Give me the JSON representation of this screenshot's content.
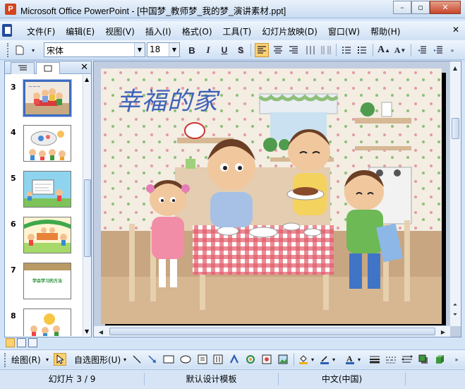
{
  "window": {
    "title": "Microsoft Office PowerPoint - [中国梦_教师梦_我的梦_演讲素材.ppt]",
    "app_icon": "P",
    "minimize": "–",
    "restore": "▫",
    "close": "✕"
  },
  "menu": {
    "items": [
      "文件(F)",
      "编辑(E)",
      "视图(V)",
      "插入(I)",
      "格式(O)",
      "工具(T)",
      "幻灯片放映(D)",
      "窗口(W)",
      "帮助(H)"
    ],
    "close_doc": "✕"
  },
  "format_toolbar": {
    "font_name": "宋体",
    "font_size": "18",
    "bold": "B",
    "italic": "I",
    "underline": "U",
    "shadow": "S",
    "grow_font": "A",
    "shrink_font": "A"
  },
  "left_pane": {
    "close": "✕",
    "slides": [
      {
        "number": "3",
        "selected": true,
        "caption": ""
      },
      {
        "number": "4",
        "selected": false,
        "caption": ""
      },
      {
        "number": "5",
        "selected": false,
        "caption": ""
      },
      {
        "number": "6",
        "selected": false,
        "caption": ""
      },
      {
        "number": "7",
        "selected": false,
        "caption": "学会学习的方法"
      },
      {
        "number": "8",
        "selected": false,
        "caption": ""
      }
    ]
  },
  "slide": {
    "title": "幸福的家"
  },
  "draw_toolbar": {
    "draw_menu": "绘图(R)",
    "autoshapes": "自选图形(U)"
  },
  "status": {
    "slide_counter": "幻灯片 3 / 9",
    "design_template": "默认设计模板",
    "language": "中文(中国)"
  },
  "colors": {
    "title_blue": "#3d62b9",
    "close_red": "#c7452b",
    "selection_blue": "#3d6cc0"
  }
}
